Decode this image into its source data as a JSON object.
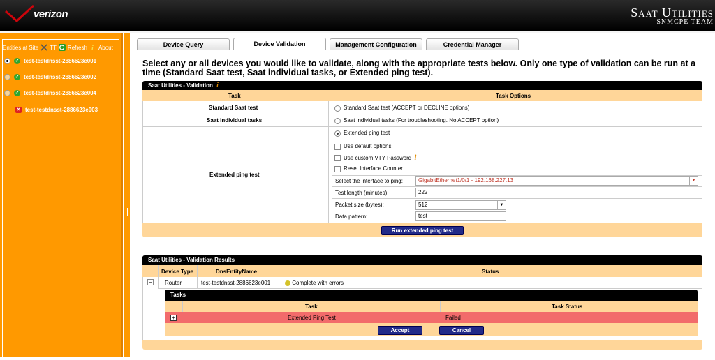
{
  "header": {
    "brand": "verizon",
    "title": "Saat Utilities",
    "subtitle": "SNMCPE TEAM",
    "accent": "#ff9900",
    "brand_red": "#cd040b"
  },
  "sidebar": {
    "toolbar": {
      "entities_label": "Entities at Site",
      "tt_label": "TT",
      "refresh_label": "Refresh",
      "about_label": "About"
    },
    "items": [
      {
        "label": "test-testdnsst-2886623e001",
        "radio": "selected",
        "status": "ok"
      },
      {
        "label": "test-testdnsst-2886623e002",
        "radio": "unselected",
        "status": "ok"
      },
      {
        "label": "test-testdnsst-2886623e004",
        "radio": "unselected",
        "status": "ok"
      },
      {
        "label": "test-testdnsst-2886623e003",
        "radio": "none",
        "status": "error"
      }
    ]
  },
  "tabs": [
    {
      "label": "Device Query",
      "active": false
    },
    {
      "label": "Device Validation",
      "active": true
    },
    {
      "label": "Management Configuration",
      "active": false
    },
    {
      "label": "Credential Manager",
      "active": false
    }
  ],
  "instructions": "Select any or all devices you would like to validate, along with the appropriate tests below. Only one type of validation can be run at a time (Standard Saat test, Saat individual tasks, or Extended ping test).",
  "validation": {
    "panel_title": "Saat Utilities - Validation",
    "col_task": "Task",
    "col_options": "Task Options",
    "rows": {
      "standard_task": "Standard Saat test",
      "standard_option": "Standard Saat test (ACCEPT or DECLINE options)",
      "individual_task": "Saat individual tasks",
      "individual_option": "Saat individual tasks (For troubleshooting. No ACCEPT option)",
      "extended_task": "Extended ping test",
      "extended_option": "Extended ping test"
    },
    "extended": {
      "use_default": "Use default options",
      "use_custom_vty": "Use custom VTY Password",
      "reset_counter": "Reset Interface Counter",
      "interface_label": "Select the interface to ping:",
      "interface_value": "GigabitEthernet1/0/1 - 192.168.227.13",
      "test_length_label": "Test length (minutes):",
      "test_length_value": "222",
      "packet_size_label": "Packet size (bytes):",
      "packet_size_value": "512",
      "data_pattern_label": "Data pattern:",
      "data_pattern_value": "test"
    },
    "run_button": "Run extended ping test"
  },
  "results": {
    "panel_title": "Saat Utilities - Validation Results",
    "col_device_type": "Device Type",
    "col_dns": "DnsEntityName",
    "col_status": "Status",
    "row": {
      "expand": "−",
      "device_type": "Router",
      "dns": "test-testdnsst-2886623e001",
      "status": "Complete with errors"
    },
    "tasks": {
      "title": "Tasks",
      "col_task": "Task",
      "col_status": "Task Status",
      "rows": [
        {
          "expand": "+",
          "task": "Extended Ping Test",
          "status": "Failed"
        }
      ],
      "accept_button": "Accept",
      "cancel_button": "Cancel",
      "failed_color": "#f26b6b"
    }
  }
}
